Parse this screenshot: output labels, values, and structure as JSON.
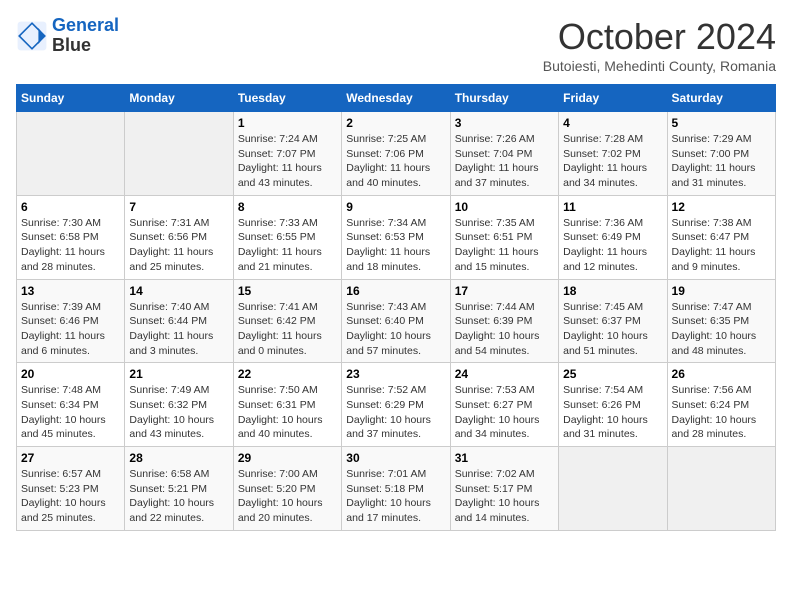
{
  "header": {
    "logo_line1": "General",
    "logo_line2": "Blue",
    "month": "October 2024",
    "location": "Butoiesti, Mehedinti County, Romania"
  },
  "days_of_week": [
    "Sunday",
    "Monday",
    "Tuesday",
    "Wednesday",
    "Thursday",
    "Friday",
    "Saturday"
  ],
  "weeks": [
    [
      {
        "day": "",
        "content": ""
      },
      {
        "day": "",
        "content": ""
      },
      {
        "day": "1",
        "content": "Sunrise: 7:24 AM\nSunset: 7:07 PM\nDaylight: 11 hours and 43 minutes."
      },
      {
        "day": "2",
        "content": "Sunrise: 7:25 AM\nSunset: 7:06 PM\nDaylight: 11 hours and 40 minutes."
      },
      {
        "day": "3",
        "content": "Sunrise: 7:26 AM\nSunset: 7:04 PM\nDaylight: 11 hours and 37 minutes."
      },
      {
        "day": "4",
        "content": "Sunrise: 7:28 AM\nSunset: 7:02 PM\nDaylight: 11 hours and 34 minutes."
      },
      {
        "day": "5",
        "content": "Sunrise: 7:29 AM\nSunset: 7:00 PM\nDaylight: 11 hours and 31 minutes."
      }
    ],
    [
      {
        "day": "6",
        "content": "Sunrise: 7:30 AM\nSunset: 6:58 PM\nDaylight: 11 hours and 28 minutes."
      },
      {
        "day": "7",
        "content": "Sunrise: 7:31 AM\nSunset: 6:56 PM\nDaylight: 11 hours and 25 minutes."
      },
      {
        "day": "8",
        "content": "Sunrise: 7:33 AM\nSunset: 6:55 PM\nDaylight: 11 hours and 21 minutes."
      },
      {
        "day": "9",
        "content": "Sunrise: 7:34 AM\nSunset: 6:53 PM\nDaylight: 11 hours and 18 minutes."
      },
      {
        "day": "10",
        "content": "Sunrise: 7:35 AM\nSunset: 6:51 PM\nDaylight: 11 hours and 15 minutes."
      },
      {
        "day": "11",
        "content": "Sunrise: 7:36 AM\nSunset: 6:49 PM\nDaylight: 11 hours and 12 minutes."
      },
      {
        "day": "12",
        "content": "Sunrise: 7:38 AM\nSunset: 6:47 PM\nDaylight: 11 hours and 9 minutes."
      }
    ],
    [
      {
        "day": "13",
        "content": "Sunrise: 7:39 AM\nSunset: 6:46 PM\nDaylight: 11 hours and 6 minutes."
      },
      {
        "day": "14",
        "content": "Sunrise: 7:40 AM\nSunset: 6:44 PM\nDaylight: 11 hours and 3 minutes."
      },
      {
        "day": "15",
        "content": "Sunrise: 7:41 AM\nSunset: 6:42 PM\nDaylight: 11 hours and 0 minutes."
      },
      {
        "day": "16",
        "content": "Sunrise: 7:43 AM\nSunset: 6:40 PM\nDaylight: 10 hours and 57 minutes."
      },
      {
        "day": "17",
        "content": "Sunrise: 7:44 AM\nSunset: 6:39 PM\nDaylight: 10 hours and 54 minutes."
      },
      {
        "day": "18",
        "content": "Sunrise: 7:45 AM\nSunset: 6:37 PM\nDaylight: 10 hours and 51 minutes."
      },
      {
        "day": "19",
        "content": "Sunrise: 7:47 AM\nSunset: 6:35 PM\nDaylight: 10 hours and 48 minutes."
      }
    ],
    [
      {
        "day": "20",
        "content": "Sunrise: 7:48 AM\nSunset: 6:34 PM\nDaylight: 10 hours and 45 minutes."
      },
      {
        "day": "21",
        "content": "Sunrise: 7:49 AM\nSunset: 6:32 PM\nDaylight: 10 hours and 43 minutes."
      },
      {
        "day": "22",
        "content": "Sunrise: 7:50 AM\nSunset: 6:31 PM\nDaylight: 10 hours and 40 minutes."
      },
      {
        "day": "23",
        "content": "Sunrise: 7:52 AM\nSunset: 6:29 PM\nDaylight: 10 hours and 37 minutes."
      },
      {
        "day": "24",
        "content": "Sunrise: 7:53 AM\nSunset: 6:27 PM\nDaylight: 10 hours and 34 minutes."
      },
      {
        "day": "25",
        "content": "Sunrise: 7:54 AM\nSunset: 6:26 PM\nDaylight: 10 hours and 31 minutes."
      },
      {
        "day": "26",
        "content": "Sunrise: 7:56 AM\nSunset: 6:24 PM\nDaylight: 10 hours and 28 minutes."
      }
    ],
    [
      {
        "day": "27",
        "content": "Sunrise: 6:57 AM\nSunset: 5:23 PM\nDaylight: 10 hours and 25 minutes."
      },
      {
        "day": "28",
        "content": "Sunrise: 6:58 AM\nSunset: 5:21 PM\nDaylight: 10 hours and 22 minutes."
      },
      {
        "day": "29",
        "content": "Sunrise: 7:00 AM\nSunset: 5:20 PM\nDaylight: 10 hours and 20 minutes."
      },
      {
        "day": "30",
        "content": "Sunrise: 7:01 AM\nSunset: 5:18 PM\nDaylight: 10 hours and 17 minutes."
      },
      {
        "day": "31",
        "content": "Sunrise: 7:02 AM\nSunset: 5:17 PM\nDaylight: 10 hours and 14 minutes."
      },
      {
        "day": "",
        "content": ""
      },
      {
        "day": "",
        "content": ""
      }
    ]
  ]
}
